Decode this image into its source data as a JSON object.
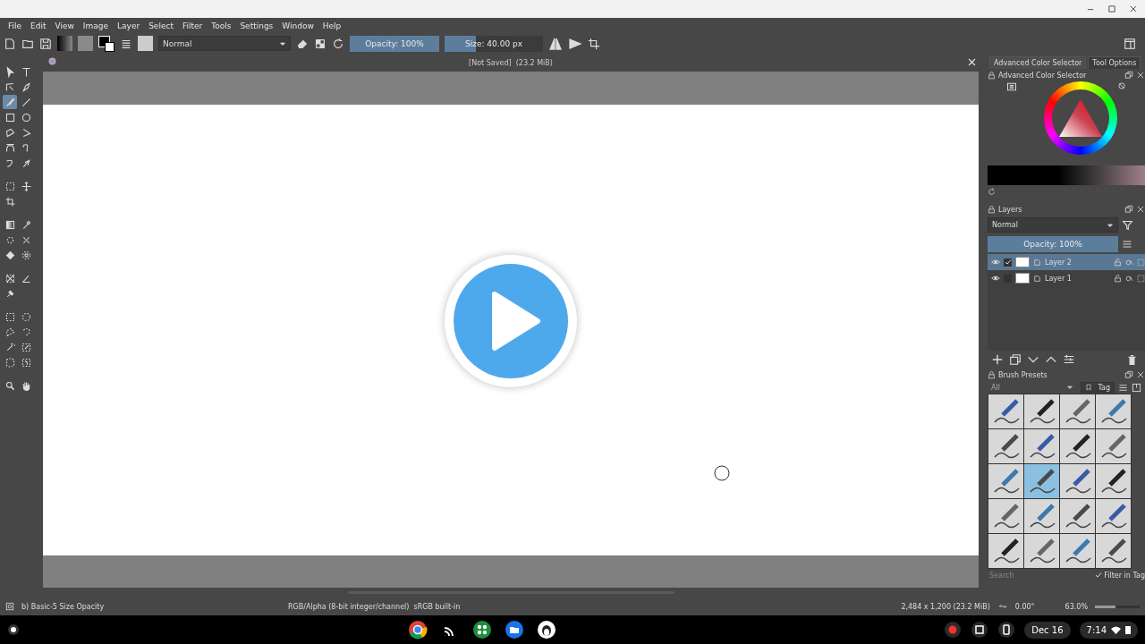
{
  "menu": [
    "File",
    "Edit",
    "View",
    "Image",
    "Layer",
    "Select",
    "Filter",
    "Tools",
    "Settings",
    "Window",
    "Help"
  ],
  "toolbar": {
    "blend_mode": "Normal",
    "opacity": {
      "label": "Opacity: 100%",
      "level": 1
    },
    "size": {
      "label": "Size: 40.00 px",
      "level": 0.32
    }
  },
  "toolbox": {
    "tools": [
      {
        "selected": false
      },
      {
        "selected": false
      },
      {
        "selected": false
      },
      {
        "selected": false
      },
      {
        "selected": true
      },
      {
        "selected": false
      },
      {
        "selected": false
      },
      {
        "selected": false
      },
      {
        "selected": false
      },
      {
        "selected": false
      },
      {
        "selected": false
      },
      {
        "selected": false
      },
      {
        "selected": false
      },
      {
        "selected": false
      },
      {
        "selected": false
      },
      {
        "selected": false
      },
      {
        "selected": false
      },
      {
        "selected": false
      },
      {
        "selected": false
      },
      {
        "selected": false
      },
      {
        "selected": false
      },
      {
        "selected": false
      },
      {
        "selected": false
      },
      {
        "selected": false
      },
      {
        "selected": false
      },
      {
        "selected": false
      },
      {
        "selected": false
      },
      {
        "selected": false
      },
      {
        "selected": false
      },
      {
        "selected": false
      },
      {
        "selected": false
      },
      {
        "selected": false
      },
      {
        "selected": false
      },
      {
        "selected": false
      },
      {
        "selected": false
      },
      {
        "selected": false
      }
    ]
  },
  "document": {
    "title": "[Not Saved]  (23.2 MiB)"
  },
  "docker_tabs": [
    {
      "label": "Advanced Color Selector",
      "selected": true
    },
    {
      "label": "Tool Options",
      "selected": false
    }
  ],
  "color_selector": {
    "title": "Advanced Color Selector"
  },
  "layers": {
    "title": "Layers",
    "blend_mode": "Normal",
    "opacity": {
      "label": "Opacity:  100%",
      "level": 1
    },
    "items": [
      {
        "name": "Layer 2",
        "selected": true,
        "checked": true
      },
      {
        "name": "Layer 1",
        "selected": false,
        "checked": false
      }
    ]
  },
  "brush_presets": {
    "title": "Brush Presets",
    "filter": "All",
    "tag": "Tag",
    "search_placeholder": "Search",
    "filter_in_tag": {
      "label": "Filter in Tag",
      "checked": true
    },
    "presets": [
      {
        "selected": false
      },
      {
        "selected": false
      },
      {
        "selected": false
      },
      {
        "selected": false
      },
      {
        "selected": false
      },
      {
        "selected": false
      },
      {
        "selected": false
      },
      {
        "selected": false
      },
      {
        "selected": false
      },
      {
        "selected": true
      },
      {
        "selected": false
      },
      {
        "selected": false
      },
      {
        "selected": false
      },
      {
        "selected": false
      },
      {
        "selected": false
      },
      {
        "selected": false
      },
      {
        "selected": false
      },
      {
        "selected": false
      },
      {
        "selected": false
      },
      {
        "selected": false
      }
    ]
  },
  "status_bar": {
    "brush": "b) Basic-5 Size Opacity",
    "color_space": "RGB/Alpha (8-bit integer/channel)  sRGB built-in",
    "image_size": "2,484 x 1,200 (23.2 MiB)",
    "rotation": "0.00°",
    "zoom": "63.0%",
    "zoom_slider": {
      "level": 0.45
    }
  },
  "shelf": {
    "date": "Dec 16",
    "time": "7:14"
  }
}
